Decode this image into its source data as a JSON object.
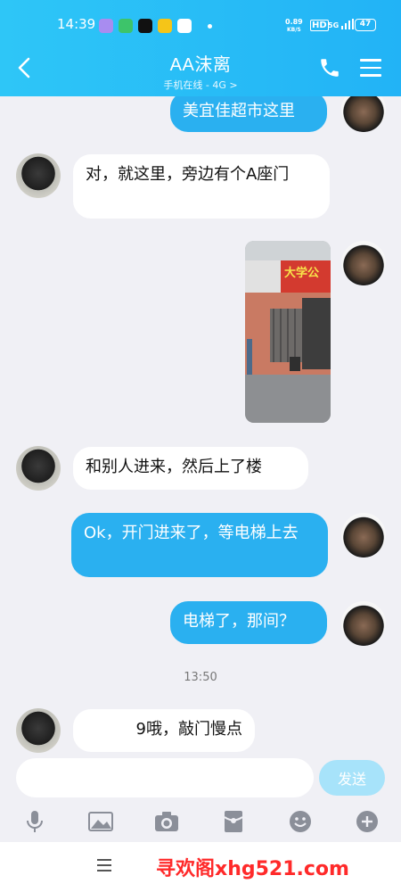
{
  "status_bar": {
    "time": "14:39",
    "net_speed_value": "0.89",
    "net_speed_unit": "KB/S",
    "hd": "HD",
    "signal": "5G",
    "battery": "47"
  },
  "header": {
    "title": "AA沫离",
    "subtitle": "手机在线 - 4G >"
  },
  "messages": {
    "m1": "美宜佳超市这里",
    "m2": "对，就这里，旁边有个A座门",
    "m4": "和别人进来，然后上了楼",
    "m5": "Ok，开门进来了，等电梯上去",
    "m6": "电梯了，那间？",
    "m7": "9哦，敲门慢点"
  },
  "photo_sign_text": "大学公",
  "time_separator": "13:50",
  "input": {
    "placeholder": "",
    "send_label": "发送"
  },
  "footer": {
    "watermark": "寻欢阁xhg521.com"
  },
  "colors": {
    "header_blue": "#22b3f6",
    "bubble_blue": "#2ab0f0",
    "send_disabled": "#a7e3fa",
    "watermark_red": "#ff2a2a"
  }
}
